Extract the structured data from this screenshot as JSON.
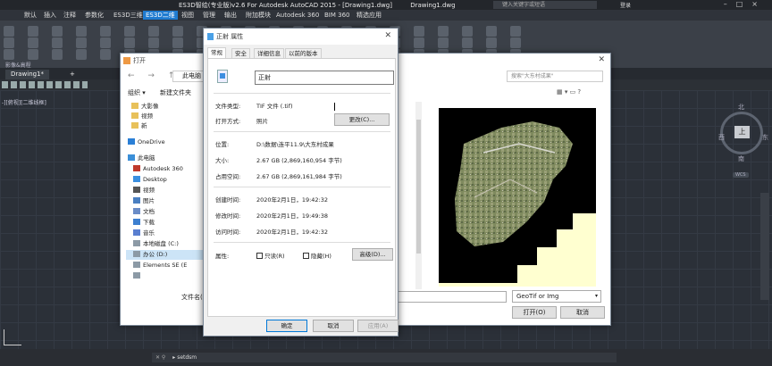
{
  "autocad": {
    "title_text": "ES3D智绘(专业版)v2.6 For Autodesk AutoCAD 2015 - [Drawing1.dwg]",
    "title_file": "Drawing1.dwg",
    "search_placeholder": "键入关键字或短语",
    "user_label": "登录",
    "ribbon_tabs": [
      "默认",
      "插入",
      "注释",
      "参数化",
      "ES3D三维",
      "ES3D二维",
      "视图",
      "管理",
      "输出",
      "附加模块",
      "Autodesk 360",
      "BIM 360",
      "精选应用"
    ],
    "active_ribbon_tab": "ES3D二维",
    "panel_label": "影像&高程",
    "file_tab": "Drawing1*",
    "add_tab": "+",
    "viewport_label": "-][俯视][二维线框]",
    "viewcube": {
      "top": "北",
      "left": "西",
      "right": "东",
      "bottom": "南",
      "face": "上",
      "wcs": "WCS"
    },
    "command_line": "setdsm",
    "cmd_prompt": "▸"
  },
  "open_dialog": {
    "title": "打开",
    "address": "此电脑",
    "search_placeholder": "搜索\"大东村成果\"",
    "organize": "组织 ▾",
    "new_folder": "新建文件夹",
    "tree": [
      {
        "label": "大影像",
        "icon": "folder"
      },
      {
        "label": "视频",
        "icon": "folder"
      },
      {
        "label": "新",
        "icon": "folder"
      },
      {
        "label": "OneDrive",
        "icon": "cloud"
      },
      {
        "label": "此电脑",
        "icon": "pc"
      },
      {
        "label": "Autodesk 360",
        "icon": "a360"
      },
      {
        "label": "Desktop",
        "icon": "desktop"
      },
      {
        "label": "视频",
        "icon": "video"
      },
      {
        "label": "图片",
        "icon": "picture"
      },
      {
        "label": "文档",
        "icon": "doc"
      },
      {
        "label": "下载",
        "icon": "download"
      },
      {
        "label": "音乐",
        "icon": "music"
      },
      {
        "label": "本地磁盘 (C:)",
        "icon": "drive"
      },
      {
        "label": "办公 (D:)",
        "icon": "drive"
      },
      {
        "label": "Elements SE (E",
        "icon": "drive"
      },
      {
        "label": "",
        "icon": "drive"
      }
    ],
    "filename_label": "文件名(N",
    "filter": "GeoTif or Img",
    "open_button": "打开(O)",
    "cancel_button": "取消"
  },
  "properties_dialog": {
    "title": "正射 属性",
    "tabs": [
      "常规",
      "安全",
      "详细信息",
      "以前的版本"
    ],
    "active_tab": "常规",
    "name": "正射",
    "rows": {
      "file_type_label": "文件类型:",
      "file_type": "TIF 文件 (.tif)",
      "open_with_label": "打开方式:",
      "open_with": "照片",
      "change_button": "更改(C)...",
      "location_label": "位置:",
      "location": "D:\\数据\\连平11.9\\大东村成果",
      "size_label": "大小:",
      "size": "2.67 GB (2,869,160,954 字节)",
      "disk_size_label": "占用空间:",
      "disk_size": "2.67 GB (2,869,161,984 字节)",
      "created_label": "创建时间:",
      "created": "2020年2月1日，19:42:32",
      "modified_label": "修改时间:",
      "modified": "2020年2月1日，19:49:38",
      "accessed_label": "访问时间:",
      "accessed": "2020年2月1日，19:42:32",
      "attributes_label": "属性:",
      "readonly_label": "只读(R)",
      "hidden_label": "隐藏(H)",
      "advanced_button": "高级(D)..."
    },
    "ok_button": "确定",
    "cancel_button": "取消",
    "apply_button": "应用(A)"
  }
}
